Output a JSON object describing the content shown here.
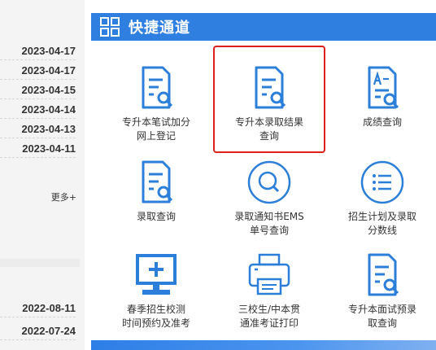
{
  "news_top": {
    "dates": [
      "2023-04-17",
      "2023-04-17",
      "2023-04-15",
      "2023-04-14",
      "2023-04-13",
      "2023-04-11"
    ],
    "more_label": "更多+"
  },
  "news_bottom": {
    "dates": [
      "2022-08-11",
      "2022-07-24"
    ]
  },
  "quick": {
    "title": "快捷通道",
    "tiles": [
      {
        "label1": "专升本笔试加分",
        "label2": "网上登记",
        "icon": "document-search-icon"
      },
      {
        "label1": "专升本录取结果",
        "label2": "查询",
        "icon": "document-search-icon"
      },
      {
        "label1": "成绩查询",
        "label2": "",
        "icon": "score-document-icon"
      },
      {
        "label1": "录取查询",
        "label2": "",
        "icon": "document-search-icon"
      },
      {
        "label1": "录取通知书EMS",
        "label2": "单号查询",
        "icon": "magnifier-circle-icon"
      },
      {
        "label1": "招生计划及录取",
        "label2": "分数线",
        "icon": "list-circle-icon"
      },
      {
        "label1": "春季招生校测",
        "label2": "时间预约及准考",
        "icon": "monitor-plus-icon"
      },
      {
        "label1": "三校生/中本贯",
        "label2": "通准考证打印",
        "icon": "printer-icon"
      },
      {
        "label1": "专升本面试预录",
        "label2": "取查询",
        "icon": "document-search-icon"
      }
    ]
  },
  "colors": {
    "accent": "#2f7fe0",
    "highlight": "#e0211b",
    "icon_blue": "#2c7fd9"
  }
}
